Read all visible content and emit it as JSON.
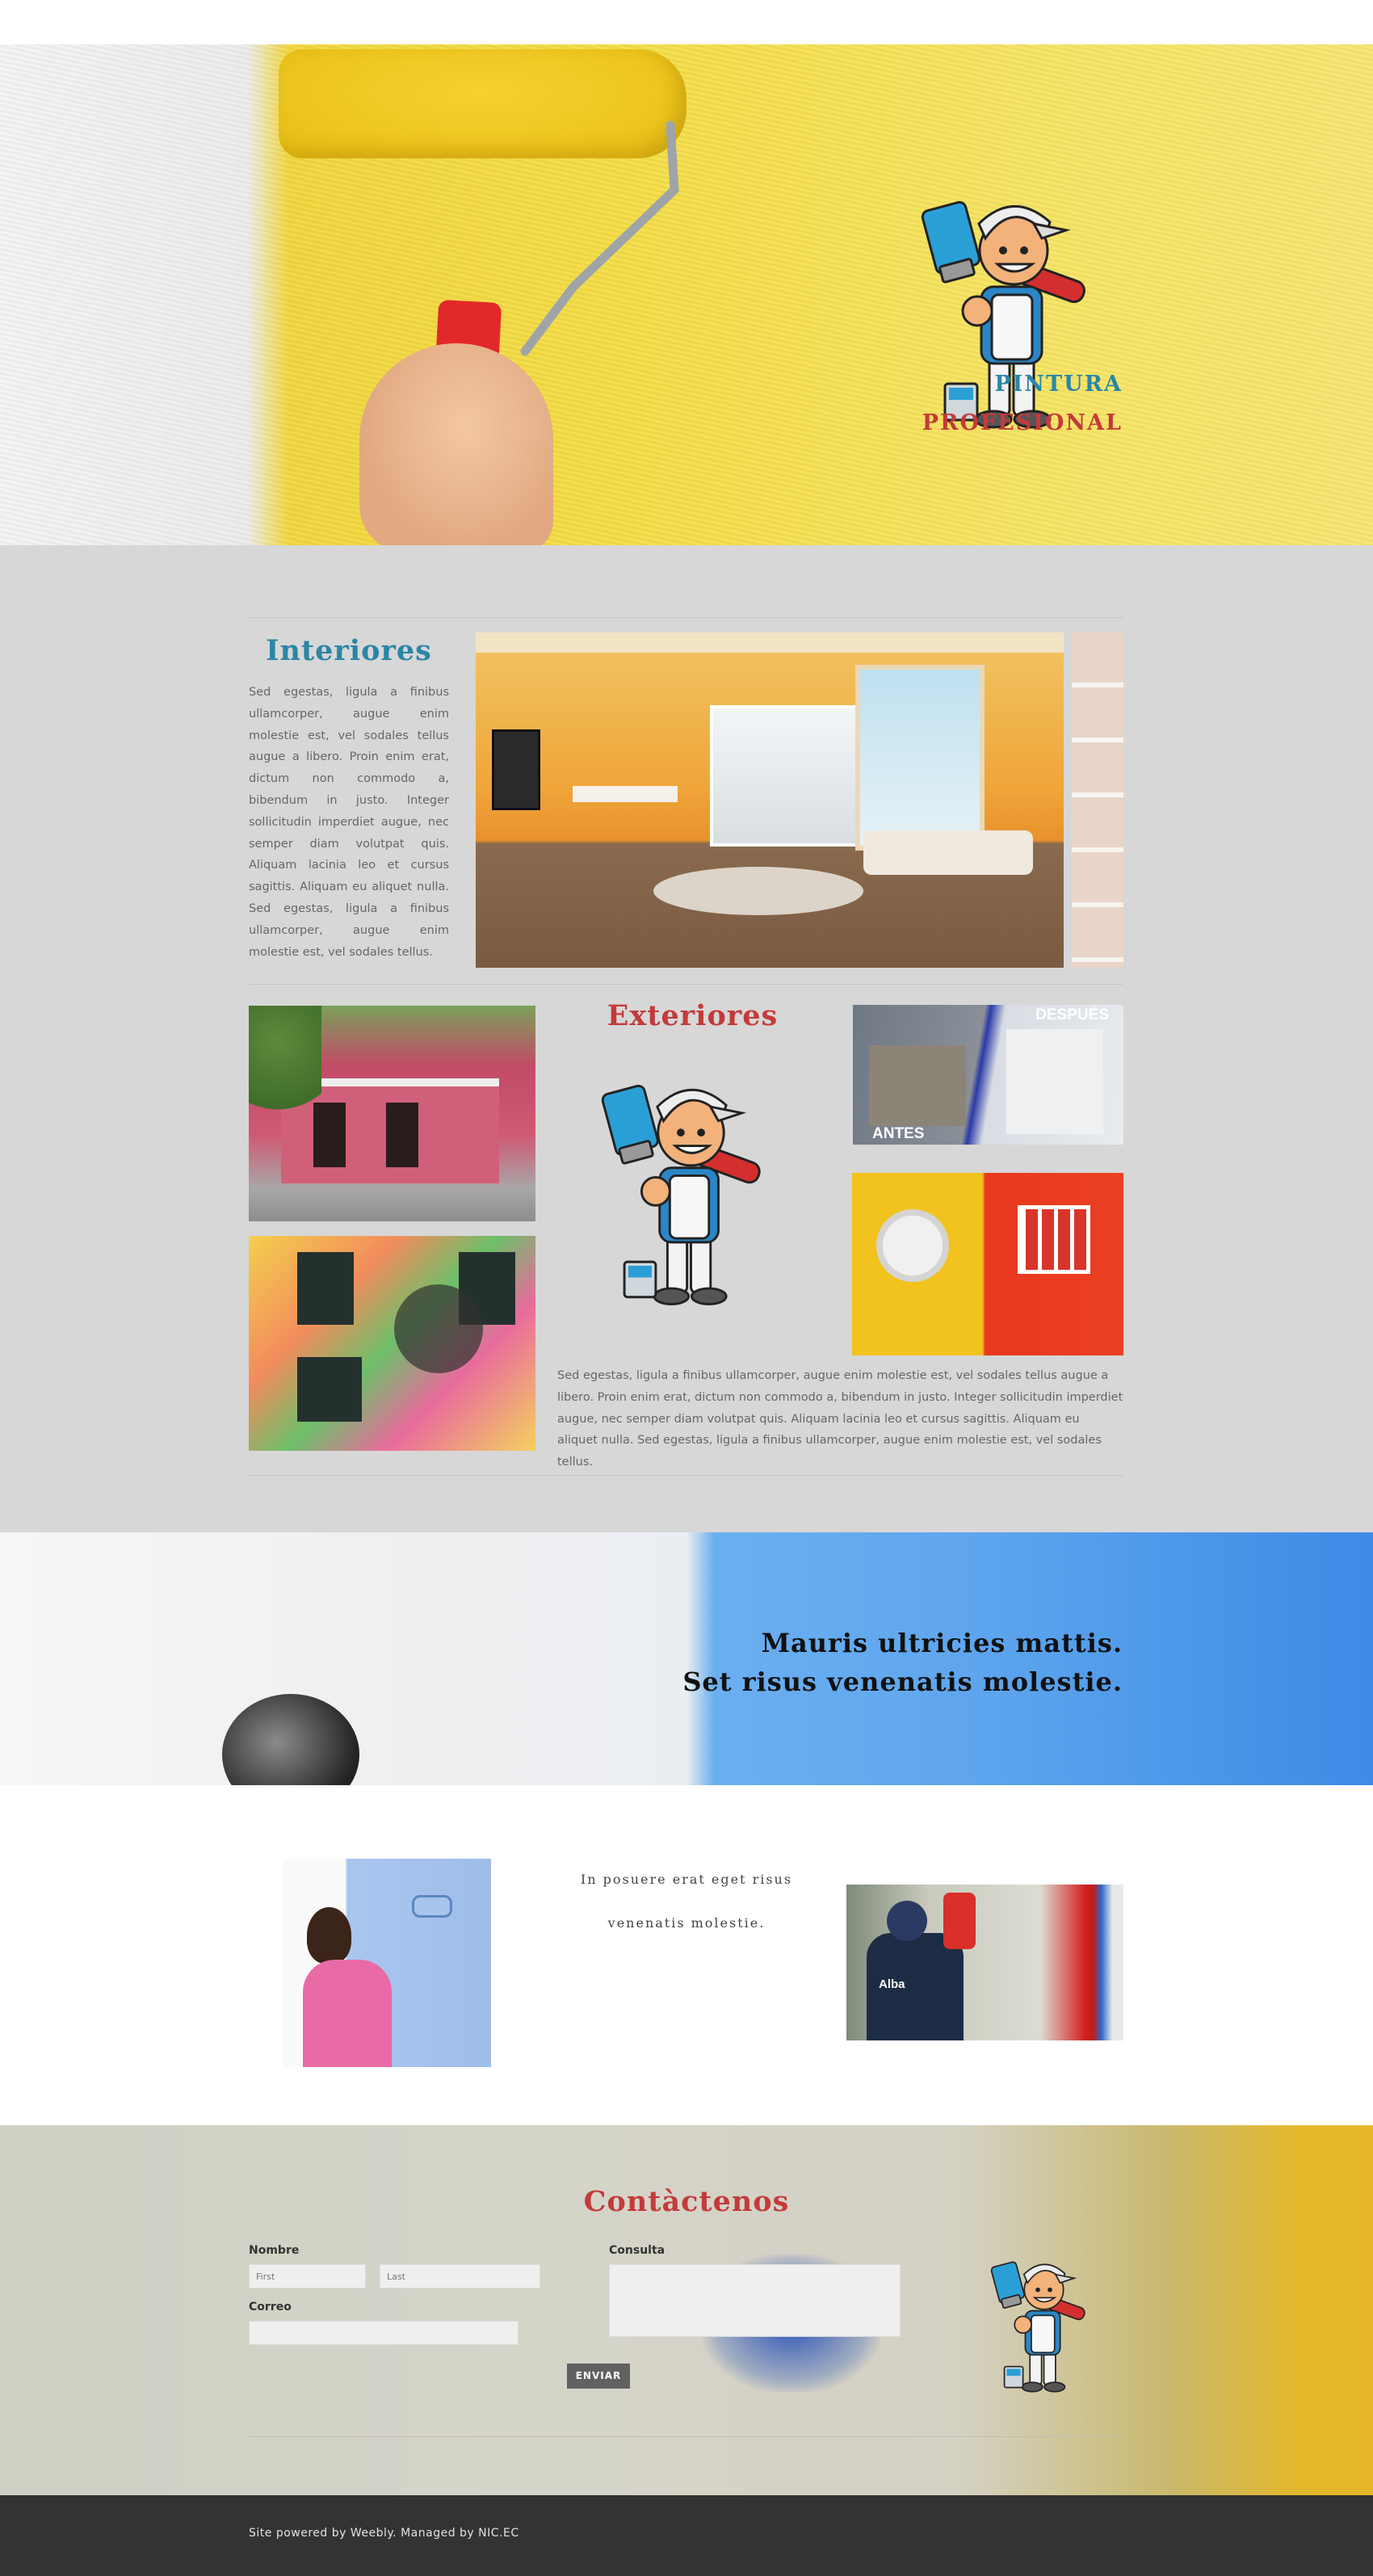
{
  "hero": {
    "line1": "PINTURA",
    "line2": "PROFESIONAL"
  },
  "interiores": {
    "title": "Interiores",
    "body": "Sed egestas, ligula a finibus ullamcorper, augue enim molestie est, vel sodales tellus augue a libero. Proin enim erat, dictum non commodo a, bibendum in justo. Integer sollicitudin imperdiet augue, nec semper diam volutpat quis. Aliquam lacinia leo et cursus sagittis. Aliquam eu aliquet nulla. Sed egestas, ligula a finibus ullamcorper, augue enim molestie est, vel sodales tellus."
  },
  "exteriores": {
    "title": "Exteriores",
    "badge_after": "DESPUÉS",
    "badge_before": "ANTES",
    "body": "Sed egestas, ligula a finibus ullamcorper, augue enim molestie est, vel sodales tellus augue a libero. Proin enim erat, dictum non commodo a, bibendum in justo. Integer sollicitudin imperdiet augue, nec semper diam volutpat quis. Aliquam lacinia leo et cursus sagittis. Aliquam eu aliquet nulla. Sed egestas, ligula a finibus ullamcorper, augue enim molestie est, vel sodales tellus."
  },
  "banner": {
    "line1": "Mauris ultricies mattis.",
    "line2": "Set risus venenatis molestie."
  },
  "middle": {
    "line1": "In posuere erat eget risus",
    "line2": "venenatis molestie.",
    "shirt_text": "Alba"
  },
  "contact": {
    "title": "Contàctenos",
    "name_label": "Nombre",
    "first_placeholder": "First",
    "last_placeholder": "Last",
    "email_label": "Correo",
    "query_label": "Consulta",
    "submit_label": "ENVIAR"
  },
  "footer": {
    "text": "Site powered by Weebly. Managed by NIC.EC"
  },
  "colors": {
    "blue_heading": "#2a86a6",
    "red_heading": "#c43a3a",
    "grey_section": "#d7d7d7",
    "footer_bg": "#333333"
  }
}
